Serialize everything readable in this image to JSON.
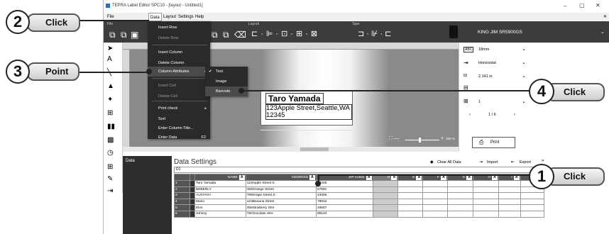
{
  "window": {
    "title": "TEPRA Label Editor SPC10 - [layout - Untitled1]"
  },
  "menubar": [
    "File",
    "Data",
    "Layout",
    "Settings",
    "Help"
  ],
  "ribbon": {
    "layout_label": "Layout",
    "tape_label": "Tape",
    "printer": "KING JIM SR5900GS"
  },
  "data_menu": {
    "items": [
      {
        "label": "Insert Row",
        "enabled": true
      },
      {
        "label": "Delete Row",
        "enabled": false
      },
      {
        "label": "Insert Column",
        "enabled": true
      },
      {
        "label": "Delete Column",
        "enabled": true
      },
      {
        "label": "Column Attributes",
        "enabled": true,
        "submenu": true
      },
      {
        "label": "Insert Cell",
        "enabled": false
      },
      {
        "label": "Delete Cell",
        "enabled": false
      },
      {
        "label": "Print check",
        "enabled": true,
        "submenu": true
      },
      {
        "label": "Sort",
        "enabled": true
      },
      {
        "label": "Enter Column Title...",
        "enabled": true
      },
      {
        "label": "Enter Data",
        "enabled": true,
        "shortcut": "F2"
      }
    ]
  },
  "submenu": {
    "items": [
      "Text",
      "Image",
      "Barcode"
    ],
    "checked": "Text",
    "hovered": "Barcode"
  },
  "label": {
    "line1": "Taro Yamada",
    "line2": "123Apple Street,Seattle,WA",
    "line3": "12345",
    "width": "2.141in"
  },
  "zoom": "150 %",
  "right_panel": {
    "tape": "18mm",
    "orientation": "Horizontal",
    "length": "2.141 in",
    "copies": "1",
    "page": "1 / 6",
    "print": "Print"
  },
  "data_settings": {
    "title": "Data Settings",
    "sidebar_label": "Data",
    "cell_ref": "D1",
    "clear_all": "Clear All Data",
    "import": "Import",
    "export": "Export",
    "columns": [
      "NAME",
      "ADDRESS",
      "ZIP CODE",
      "D",
      "E",
      "F",
      "G",
      "H",
      "I",
      "J"
    ],
    "rows": [
      [
        "1",
        "Taro Yamada",
        "123Apple Street,S",
        "12345"
      ],
      [
        "2",
        "BEBERLY",
        "456Orange Street",
        "67891"
      ],
      [
        "3",
        "AUVIYAH",
        "789Grape Street,S",
        "23456"
      ],
      [
        "4",
        "Mario",
        "123Banana Street",
        "78912"
      ],
      [
        "5",
        "Elon",
        "456Strwberry Stre",
        "34567"
      ],
      [
        "6",
        "Johnny",
        "78Chocolate Stre",
        "89123"
      ]
    ]
  },
  "callouts": [
    {
      "num": "1",
      "label": "Click"
    },
    {
      "num": "2",
      "label": "Click"
    },
    {
      "num": "3",
      "label": "Point"
    },
    {
      "num": "4",
      "label": "Click"
    }
  ],
  "colors": {
    "menu_bg": "#2a2a2a",
    "ribbon_bg": "#3c3c3c",
    "canvas_bg": "#8a8a8a"
  }
}
